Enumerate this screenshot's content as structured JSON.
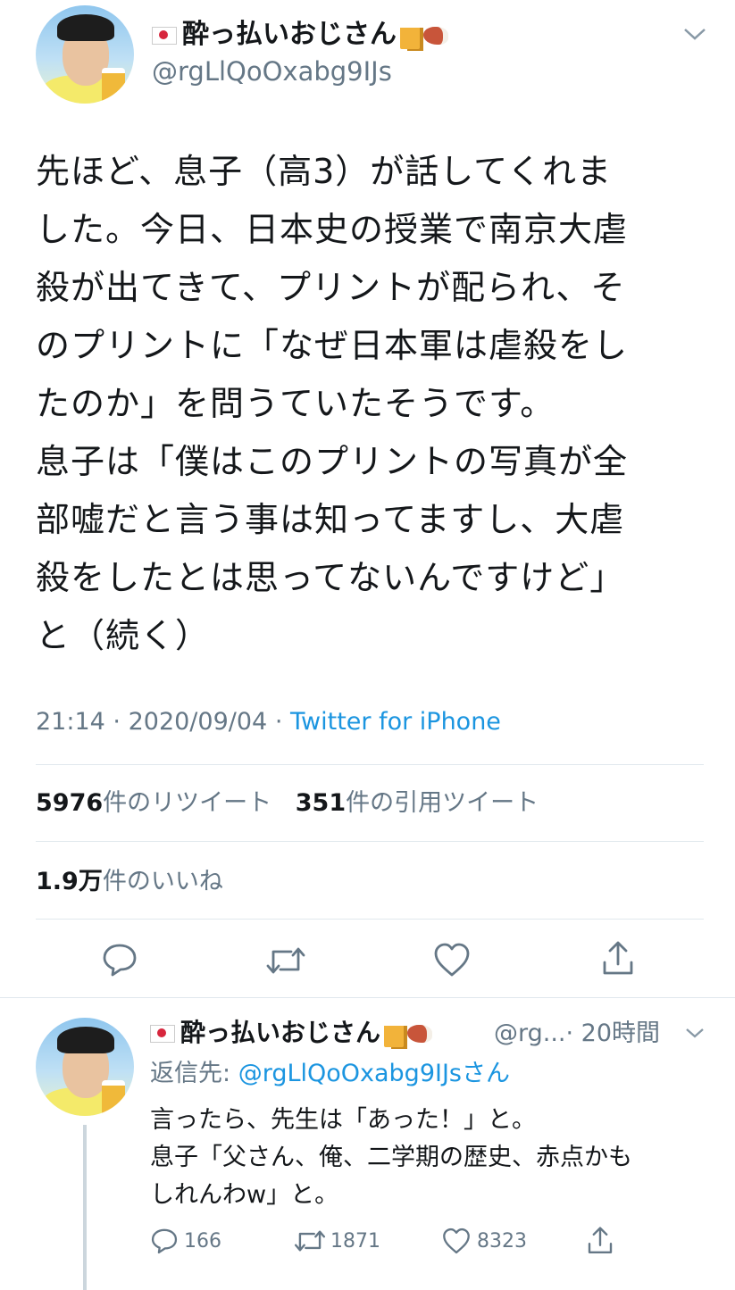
{
  "main_tweet": {
    "display_name": "酔っ払いおじさん",
    "handle": "@rgLlQoOxabg9IJs",
    "text_lines": [
      "先ほど、息子（高3）が話してくれま",
      "した。今日、日本史の授業で南京大虐",
      "殺が出てきて、プリントが配られ、そ",
      "のプリントに「なぜ日本軍は虐殺をし",
      "たのか」を問うていたそうです。",
      "息子は「僕はこのプリントの写真が全",
      "部嘘だと言う事は知ってますし、大虐",
      "殺をしたとは思ってないんですけど」",
      "と（続く）"
    ],
    "time": "21:14",
    "date": "2020/09/04",
    "separator": "·",
    "source": "Twitter for iPhone",
    "retweet_count": "5976",
    "retweet_label": "件のリツイート",
    "quote_count": "351",
    "quote_label": "件の引用ツイート",
    "like_count": "1.9万",
    "like_label": "件のいいね"
  },
  "reply_tweet": {
    "display_name": "酔っ払いおじさん",
    "handle_truncated": "@rg...",
    "time_ago": "· 20時間",
    "reply_to_prefix": "返信先: ",
    "reply_to_handle": "@rgLlQoOxabg9IJs",
    "reply_to_suffix": "さん",
    "text_lines": [
      "言ったら、先生は「あった！」と。",
      "息子「父さん、俺、二学期の歴史、赤点かも",
      "しれんわw」と。"
    ],
    "reply_count": "166",
    "retweet_count": "1871",
    "like_count": "8323"
  },
  "icons": [
    "flag-japan-icon",
    "beer-mug-icon",
    "meat-on-bone-icon",
    "chevron-down-icon",
    "reply-icon",
    "retweet-icon",
    "like-icon",
    "share-icon"
  ],
  "colors": {
    "text": "#14171a",
    "secondary": "#657786",
    "link": "#1b95e0",
    "divider": "#e1e8ed"
  }
}
